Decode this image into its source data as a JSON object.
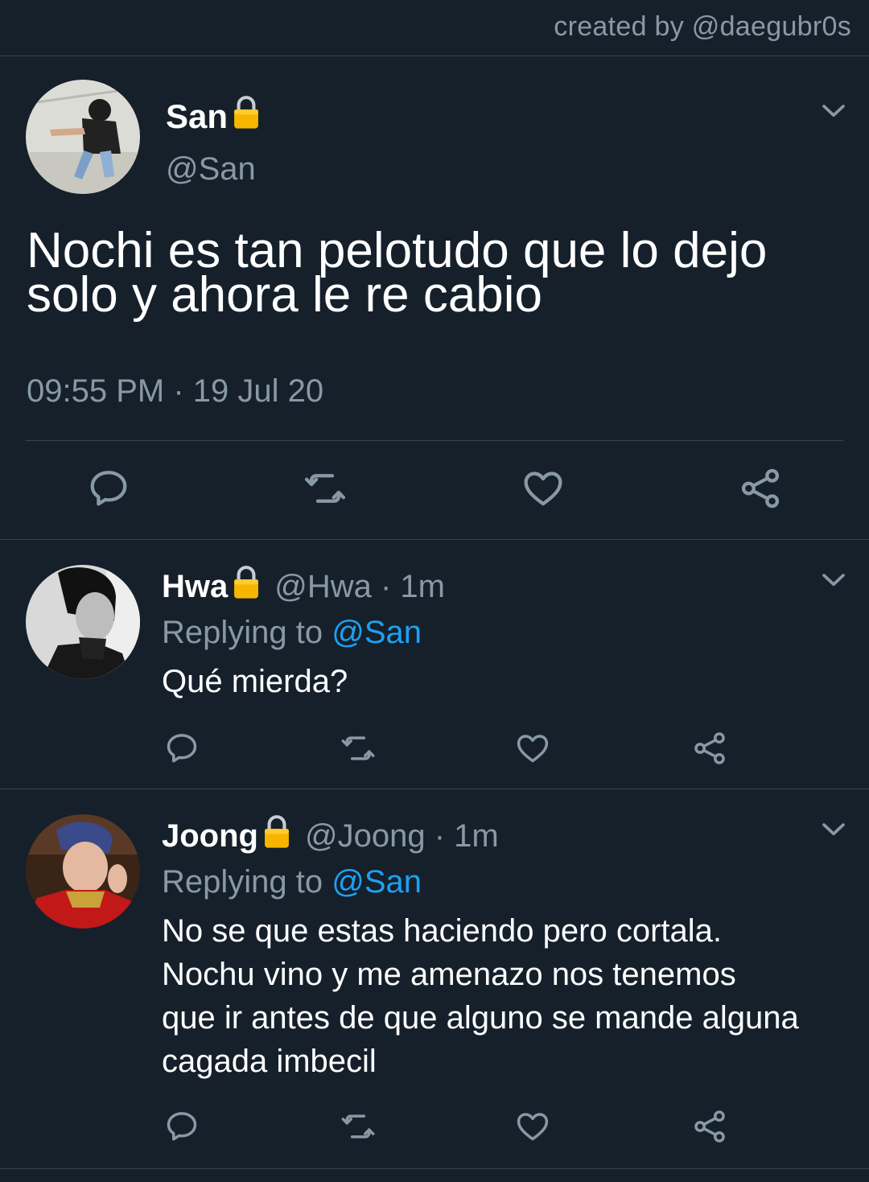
{
  "credit": "created by @daegubr0s",
  "colors": {
    "background": "#15202b",
    "secondary_text": "#8899a6",
    "link": "#1da1f2",
    "divider": "#38444d",
    "lock": "#f5b400"
  },
  "main_tweet": {
    "name": "San",
    "handle": "@San",
    "text_line1": "Nochi es tan pelotudo que lo dejo",
    "text_line2": "solo y ahora le re cabio",
    "timestamp": "09:55 PM · 19 Jul 20"
  },
  "replies": [
    {
      "name": "Hwa",
      "meta": "@Hwa · 1m",
      "replying_prefix": "Replying to ",
      "replying_to": "@San",
      "lines": [
        "Qué mierda?"
      ]
    },
    {
      "name": "Joong",
      "meta": "@Joong · 1m",
      "replying_prefix": "Replying to ",
      "replying_to": "@San",
      "lines": [
        "No se que estas haciendo pero cortala.",
        "Nochu vino y me amenazo nos tenemos",
        "que ir antes de que alguno se mande alguna",
        "cagada imbecil"
      ]
    }
  ],
  "icons": [
    "lock-icon",
    "chevron-down-icon",
    "reply-icon",
    "retweet-icon",
    "like-icon",
    "share-icon"
  ]
}
